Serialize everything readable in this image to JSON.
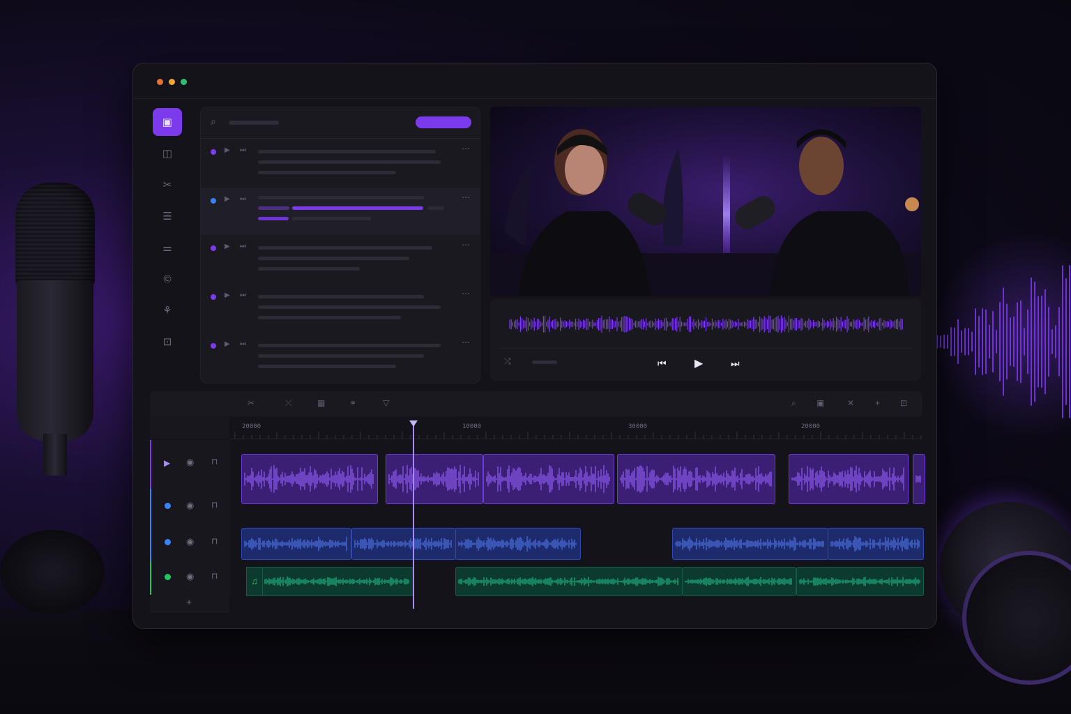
{
  "window": {
    "traffic_lights": [
      {
        "name": "close",
        "color": "#e8703a"
      },
      {
        "name": "minimize",
        "color": "#f0a43a"
      },
      {
        "name": "maximize",
        "color": "#2fbf71"
      }
    ]
  },
  "sidebar": {
    "items": [
      {
        "icon": "caption-icon",
        "active": true
      },
      {
        "icon": "media-icon",
        "active": false
      },
      {
        "icon": "cut-icon",
        "active": false
      },
      {
        "icon": "list-icon",
        "active": false
      },
      {
        "icon": "sliders-icon",
        "active": false
      },
      {
        "icon": "copyright-icon",
        "active": false
      },
      {
        "icon": "share-icon",
        "active": false
      },
      {
        "icon": "export-icon",
        "active": false
      }
    ]
  },
  "episodes": {
    "search_icon": "search-icon",
    "action_button_color": "#7c3aed",
    "rows": [
      {
        "dot": "#7c3aed",
        "selected": false
      },
      {
        "dot": "#3b82f6",
        "selected": true
      },
      {
        "dot": "#7c3aed",
        "selected": false
      },
      {
        "dot": "#7c3aed",
        "selected": false
      },
      {
        "dot": "#7c3aed",
        "selected": false
      }
    ]
  },
  "player": {
    "controls": [
      "previous-icon",
      "play-icon",
      "next-icon"
    ]
  },
  "timeline": {
    "ruler_labels": [
      "20000",
      "10000",
      "30000",
      "20000"
    ],
    "toolbar_left": [
      "cut-icon",
      "split-icon",
      "grid-icon",
      "link-icon",
      "marker-icon"
    ],
    "toolbar_right": [
      "zoom-icon",
      "box-icon",
      "close-icon",
      "add-icon",
      "fit-icon"
    ],
    "tracks": [
      {
        "color": "#7c3aed",
        "playing": true
      },
      {
        "color": "#3b82f6",
        "playing": false
      },
      {
        "color": "#3b82f6",
        "playing": false
      },
      {
        "color": "#22c55e",
        "playing": false
      }
    ],
    "add_track_label": "+"
  },
  "colors": {
    "accent": "#7c3aed",
    "voice_a": "#7c3aed",
    "voice_b": "#3b62d9",
    "music": "#159a73"
  }
}
